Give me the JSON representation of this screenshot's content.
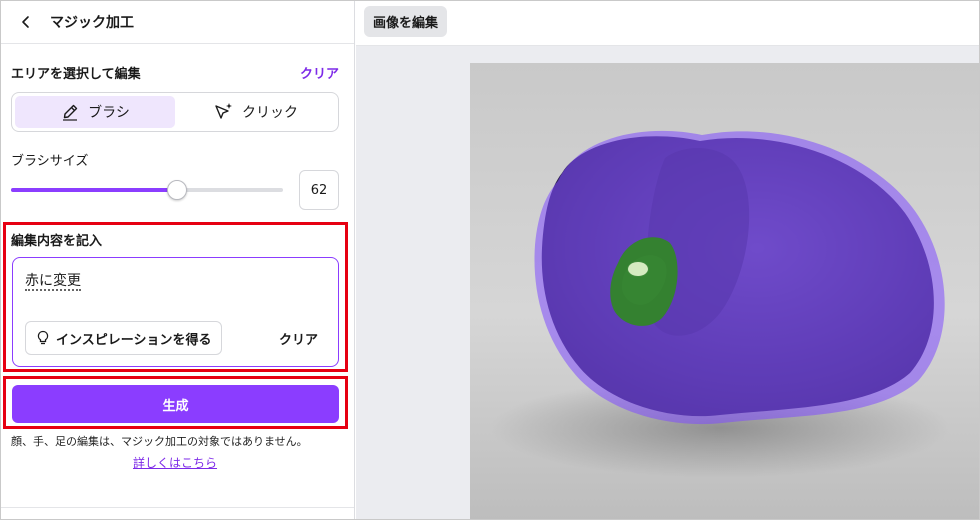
{
  "panel": {
    "title": "マジック加工",
    "area_section_title": "エリアを選択して編集",
    "clear_label": "クリア",
    "modes": [
      {
        "label": "ブラシ",
        "icon": "brush-icon",
        "active": true
      },
      {
        "label": "クリック",
        "icon": "cursor-sparkle-icon",
        "active": false
      }
    ],
    "brush_size_label": "ブラシサイズ",
    "brush_size_value": "62",
    "brush_size_fraction": 0.61,
    "edit_section_title": "編集内容を記入",
    "prompt_text": "赤に変更",
    "inspire_label": "インスピレーションを得る",
    "prompt_clear_label": "クリア",
    "generate_label": "生成",
    "notice": "顔、手、足の編集は、マジック加工の対象ではありません。",
    "learn_more": "詳しくはこちら"
  },
  "toolbar": {
    "edit_image_tab": "画像を編集"
  },
  "colors": {
    "accent": "#8b3dff",
    "highlight_border": "#e60012",
    "selection_overlay": "#7f4dff"
  },
  "canvas": {
    "image": "bell pepper with purple brush selection overlay"
  }
}
